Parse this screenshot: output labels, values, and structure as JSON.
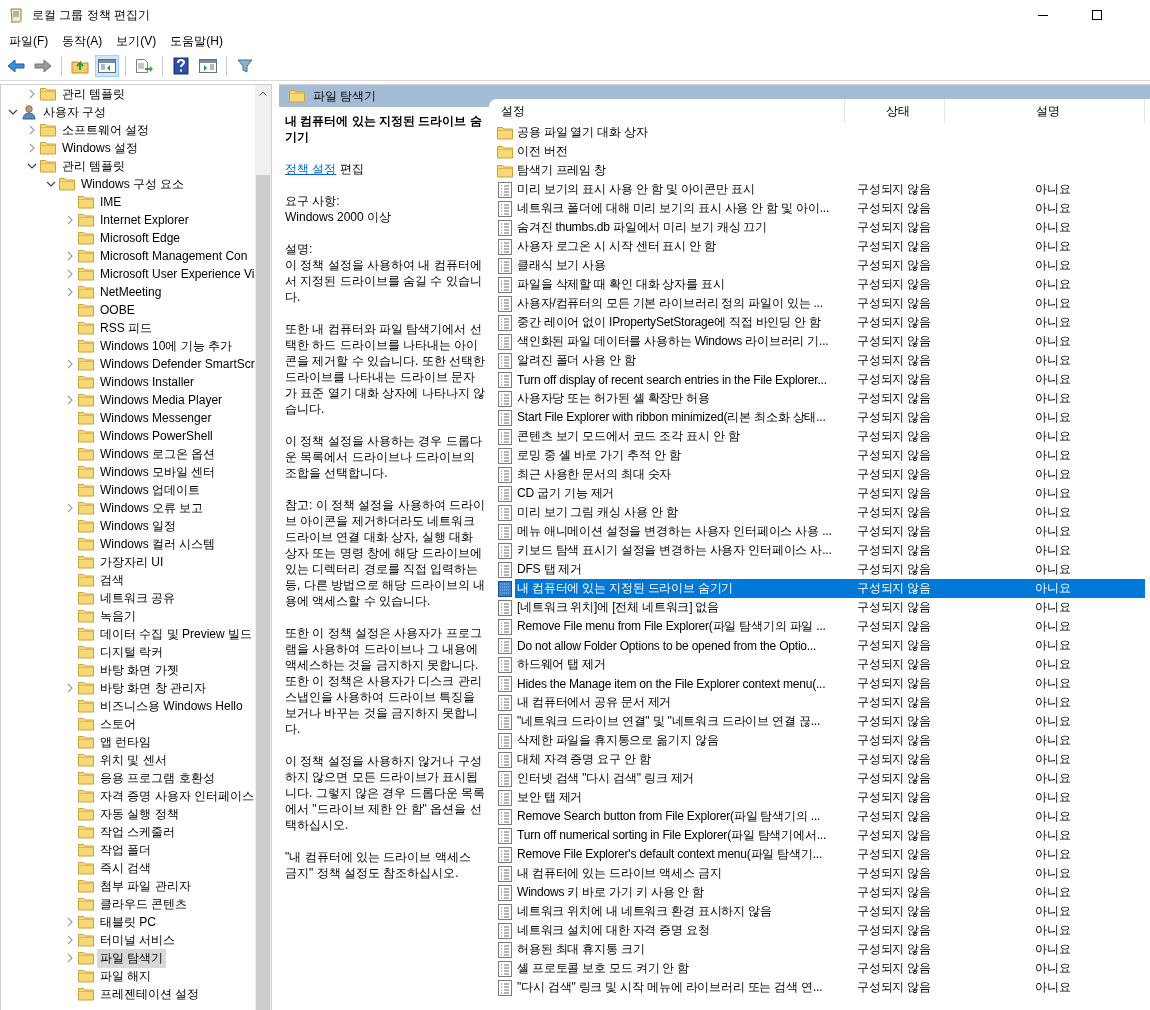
{
  "window": {
    "title": "로컬 그룹 정책 편집기"
  },
  "menu": [
    {
      "label": "파일(F)"
    },
    {
      "label": "동작(A)"
    },
    {
      "label": "보기(V)"
    },
    {
      "label": "도움말(H)"
    }
  ],
  "toolbar": [
    [
      {
        "kind": "back",
        "disabled": false,
        "pressed": false
      },
      {
        "kind": "forward",
        "disabled": true,
        "pressed": false
      }
    ],
    [
      {
        "kind": "up",
        "disabled": false,
        "pressed": false
      },
      {
        "kind": "tree-toggle",
        "disabled": false,
        "pressed": true
      }
    ],
    [
      {
        "kind": "export",
        "disabled": false,
        "pressed": false
      }
    ],
    [
      {
        "kind": "help",
        "disabled": false,
        "pressed": false
      },
      {
        "kind": "pane-toggle",
        "disabled": false,
        "pressed": false
      }
    ],
    [
      {
        "kind": "filter",
        "disabled": false,
        "pressed": false
      }
    ]
  ],
  "tree": [
    {
      "children": [
        {
          "label": "관리 템플릿",
          "kind": "folder",
          "expandable": true,
          "expanded": false,
          "selected": false
        }
      ]
    },
    {
      "label": "사용자 구성",
      "kind": "user",
      "expandable": true,
      "expanded": true,
      "selected": false,
      "children": [
        {
          "label": "소프트웨어 설정",
          "kind": "folder",
          "expandable": true,
          "expanded": false,
          "selected": false
        },
        {
          "label": "Windows 설정",
          "kind": "folder",
          "expandable": true,
          "expanded": false,
          "selected": false
        },
        {
          "label": "관리 템플릿",
          "kind": "folder",
          "expandable": true,
          "expanded": true,
          "selected": false,
          "children": [
            {
              "label": "Windows 구성 요소",
              "kind": "folder",
              "expandable": true,
              "expanded": true,
              "selected": false,
              "children": [
                {
                  "label": "IME",
                  "kind": "folder",
                  "expandable": false,
                  "selected": false
                },
                {
                  "label": "Internet Explorer",
                  "kind": "folder",
                  "expandable": true,
                  "expanded": false,
                  "selected": false
                },
                {
                  "label": "Microsoft Edge",
                  "kind": "folder",
                  "expandable": false,
                  "selected": false
                },
                {
                  "label": "Microsoft Management Con",
                  "kind": "folder",
                  "expandable": true,
                  "expanded": false,
                  "selected": false
                },
                {
                  "label": "Microsoft User Experience Vi",
                  "kind": "folder",
                  "expandable": true,
                  "expanded": false,
                  "selected": false
                },
                {
                  "label": "NetMeeting",
                  "kind": "folder",
                  "expandable": true,
                  "expanded": false,
                  "selected": false
                },
                {
                  "label": "OOBE",
                  "kind": "folder",
                  "expandable": false,
                  "selected": false
                },
                {
                  "label": "RSS 피드",
                  "kind": "folder",
                  "expandable": false,
                  "selected": false
                },
                {
                  "label": "Windows 10에 기능 추가",
                  "kind": "folder",
                  "expandable": false,
                  "selected": false
                },
                {
                  "label": "Windows Defender SmartScr",
                  "kind": "folder",
                  "expandable": true,
                  "expanded": false,
                  "selected": false
                },
                {
                  "label": "Windows Installer",
                  "kind": "folder",
                  "expandable": false,
                  "selected": false
                },
                {
                  "label": "Windows Media Player",
                  "kind": "folder",
                  "expandable": true,
                  "expanded": false,
                  "selected": false
                },
                {
                  "label": "Windows Messenger",
                  "kind": "folder",
                  "expandable": false,
                  "selected": false
                },
                {
                  "label": "Windows PowerShell",
                  "kind": "folder",
                  "expandable": false,
                  "selected": false
                },
                {
                  "label": "Windows 로그온 옵션",
                  "kind": "folder",
                  "expandable": false,
                  "selected": false
                },
                {
                  "label": "Windows 모바일 센터",
                  "kind": "folder",
                  "expandable": false,
                  "selected": false
                },
                {
                  "label": "Windows 업데이트",
                  "kind": "folder",
                  "expandable": false,
                  "selected": false
                },
                {
                  "label": "Windows 오류 보고",
                  "kind": "folder",
                  "expandable": true,
                  "expanded": false,
                  "selected": false
                },
                {
                  "label": "Windows 일정",
                  "kind": "folder",
                  "expandable": false,
                  "selected": false
                },
                {
                  "label": "Windows 컬러 시스템",
                  "kind": "folder",
                  "expandable": false,
                  "selected": false
                },
                {
                  "label": "가장자리 UI",
                  "kind": "folder",
                  "expandable": false,
                  "selected": false
                },
                {
                  "label": "검색",
                  "kind": "folder",
                  "expandable": false,
                  "selected": false
                },
                {
                  "label": "네트워크 공유",
                  "kind": "folder",
                  "expandable": false,
                  "selected": false
                },
                {
                  "label": "녹음기",
                  "kind": "folder",
                  "expandable": false,
                  "selected": false
                },
                {
                  "label": "데이터 수집 및 Preview 빌드",
                  "kind": "folder",
                  "expandable": false,
                  "selected": false
                },
                {
                  "label": "디지털 락커",
                  "kind": "folder",
                  "expandable": false,
                  "selected": false
                },
                {
                  "label": "바탕 화면 가젯",
                  "kind": "folder",
                  "expandable": false,
                  "selected": false
                },
                {
                  "label": "바탕 화면 창 관리자",
                  "kind": "folder",
                  "expandable": true,
                  "expanded": false,
                  "selected": false
                },
                {
                  "label": "비즈니스용 Windows Hello",
                  "kind": "folder",
                  "expandable": false,
                  "selected": false
                },
                {
                  "label": "스토어",
                  "kind": "folder",
                  "expandable": false,
                  "selected": false
                },
                {
                  "label": "앱 런타임",
                  "kind": "folder",
                  "expandable": false,
                  "selected": false
                },
                {
                  "label": "위치 및 센서",
                  "kind": "folder",
                  "expandable": false,
                  "selected": false
                },
                {
                  "label": "응용 프로그램 호환성",
                  "kind": "folder",
                  "expandable": false,
                  "selected": false
                },
                {
                  "label": "자격 증명 사용자 인터페이스",
                  "kind": "folder",
                  "expandable": false,
                  "selected": false
                },
                {
                  "label": "자동 실행 정책",
                  "kind": "folder",
                  "expandable": false,
                  "selected": false
                },
                {
                  "label": "작업 스케줄러",
                  "kind": "folder",
                  "expandable": false,
                  "selected": false
                },
                {
                  "label": "작업 폴더",
                  "kind": "folder",
                  "expandable": false,
                  "selected": false
                },
                {
                  "label": "즉시 검색",
                  "kind": "folder",
                  "expandable": false,
                  "selected": false
                },
                {
                  "label": "첨부 파일 관리자",
                  "kind": "folder",
                  "expandable": false,
                  "selected": false
                },
                {
                  "label": "클라우드 콘텐츠",
                  "kind": "folder",
                  "expandable": false,
                  "selected": false
                },
                {
                  "label": "태블릿 PC",
                  "kind": "folder",
                  "expandable": true,
                  "expanded": false,
                  "selected": false
                },
                {
                  "label": "터미널 서비스",
                  "kind": "folder",
                  "expandable": true,
                  "expanded": false,
                  "selected": false
                },
                {
                  "label": "파일 탐색기",
                  "kind": "folder",
                  "expandable": true,
                  "expanded": false,
                  "selected": true
                },
                {
                  "label": "파일 해지",
                  "kind": "folder",
                  "expandable": false,
                  "selected": false
                },
                {
                  "label": "프레젠테이션 설정",
                  "kind": "folder",
                  "expandable": false,
                  "selected": false
                }
              ]
            }
          ]
        }
      ]
    }
  ],
  "pane_header": {
    "title": "파일 탐색기"
  },
  "description": {
    "title": "내 컴퓨터에 있는 지정된 드라이브 숨기기",
    "edit_link": "정책 설정",
    "edit_suffix": "편집",
    "requirements_label": "요구 사항:",
    "requirements": "Windows 2000 이상",
    "description_label": "설명:",
    "paragraphs": [
      "이 정책 설정을 사용하여 내 컴퓨터에서 지정된 드라이브를 숨길 수 있습니다.",
      "또한 내 컴퓨터와 파일 탐색기에서 선택한 하드 드라이브를 나타내는 아이콘을 제거할 수 있습니다. 또한 선택한 드라이브를 나타내는 드라이브 문자가 표준 열기 대화 상자에 나타나지 않습니다.",
      "이 정책 설정을 사용하는 경우 드롭다운 목록에서 드라이브나 드라이브의 조합을 선택합니다.",
      "참고: 이 정책 설정을 사용하여 드라이브 아이콘을 제거하더라도 네트워크 드라이브 연결 대화 상자, 실행 대화 상자 또는 명령 창에 해당 드라이브에 있는 디렉터리 경로를 직접 입력하는 등, 다른 방법으로 해당 드라이브의 내용에 액세스할 수 있습니다.",
      "또한 이 정책 설정은 사용자가 프로그램을 사용하여 드라이브나 그 내용에 액세스하는 것을 금지하지 못합니다. 또한 이 정책은 사용자가 디스크 관리 스냅인을 사용하여 드라이브 특징을 보거나 바꾸는 것을 금지하지 못합니다.",
      "이 정책 설정을 사용하지 않거나 구성하지 않으면 모든 드라이브가 표시됩니다. 그렇지 않은 경우 드롭다운 목록에서 \"드라이브 제한 안 함\" 옵션을 선택하십시오.",
      "\"내 컴퓨터에 있는 드라이브 액세스 금지\" 정책 설정도 참조하십시오."
    ]
  },
  "table": {
    "columns": [
      "설정",
      "상태",
      "설명"
    ],
    "rows": [
      {
        "kind": "folder",
        "name": "공용 파일 열기 대화 상자",
        "selected": false
      },
      {
        "kind": "folder",
        "name": "이전 버전",
        "selected": false
      },
      {
        "kind": "folder",
        "name": "탐색기 프레임 창",
        "selected": false
      },
      {
        "kind": "setting",
        "name": "미리 보기의 표시 사용 안 함 및 아이콘만 표시",
        "state": "구성되지 않음",
        "comment": "아니요",
        "selected": false
      },
      {
        "kind": "setting",
        "name": "네트워크 폴더에 대해 미리 보기의 표시 사용 안 함 및 아이...",
        "state": "구성되지 않음",
        "comment": "아니요",
        "selected": false
      },
      {
        "kind": "setting",
        "name": "숨겨진 thumbs.db 파일에서 미리 보기 캐싱 끄기",
        "state": "구성되지 않음",
        "comment": "아니요",
        "selected": false
      },
      {
        "kind": "setting",
        "name": "사용자 로그온 시 시작 센터 표시 안 함",
        "state": "구성되지 않음",
        "comment": "아니요",
        "selected": false
      },
      {
        "kind": "setting",
        "name": "클래식 보기 사용",
        "state": "구성되지 않음",
        "comment": "아니요",
        "selected": false
      },
      {
        "kind": "setting",
        "name": "파일을 삭제할 때 확인 대화 상자를 표시",
        "state": "구성되지 않음",
        "comment": "아니요",
        "selected": false
      },
      {
        "kind": "setting",
        "name": "사용자/컴퓨터의 모든 기본 라이브러리 정의 파일이 있는 ...",
        "state": "구성되지 않음",
        "comment": "아니요",
        "selected": false
      },
      {
        "kind": "setting",
        "name": "중간 레이어 없이 IPropertySetStorage에 직접 바인딩 안 함",
        "state": "구성되지 않음",
        "comment": "아니요",
        "selected": false
      },
      {
        "kind": "setting",
        "name": "색인화된 파일 데이터를 사용하는 Windows 라이브러리 기...",
        "state": "구성되지 않음",
        "comment": "아니요",
        "selected": false
      },
      {
        "kind": "setting",
        "name": "알려진 폴더 사용 안 함",
        "state": "구성되지 않음",
        "comment": "아니요",
        "selected": false
      },
      {
        "kind": "setting",
        "name": "Turn off display of recent search entries in the File Explorer...",
        "state": "구성되지 않음",
        "comment": "아니요",
        "selected": false
      },
      {
        "kind": "setting",
        "name": "사용자당 또는 허가된 셸 확장만 허용",
        "state": "구성되지 않음",
        "comment": "아니요",
        "selected": false
      },
      {
        "kind": "setting",
        "name": "Start File Explorer with ribbon minimized(리본 최소화 상태...",
        "state": "구성되지 않음",
        "comment": "아니요",
        "selected": false
      },
      {
        "kind": "setting",
        "name": "콘텐츠 보기 모드에서 코드 조각 표시 안 함",
        "state": "구성되지 않음",
        "comment": "아니요",
        "selected": false
      },
      {
        "kind": "setting",
        "name": "로밍 중 셸 바로 가기 추적 안 함",
        "state": "구성되지 않음",
        "comment": "아니요",
        "selected": false
      },
      {
        "kind": "setting",
        "name": "최근 사용한 문서의 최대 숫자",
        "state": "구성되지 않음",
        "comment": "아니요",
        "selected": false
      },
      {
        "kind": "setting",
        "name": "CD 굽기 기능 제거",
        "state": "구성되지 않음",
        "comment": "아니요",
        "selected": false
      },
      {
        "kind": "setting",
        "name": "미리 보기 그림 캐싱 사용 안 함",
        "state": "구성되지 않음",
        "comment": "아니요",
        "selected": false
      },
      {
        "kind": "setting",
        "name": "메뉴 애니메이션 설정을 변경하는 사용자 인터페이스 사용 ...",
        "state": "구성되지 않음",
        "comment": "아니요",
        "selected": false
      },
      {
        "kind": "setting",
        "name": "키보드 탐색 표시기 설정을 변경하는 사용자 인터페이스 사...",
        "state": "구성되지 않음",
        "comment": "아니요",
        "selected": false
      },
      {
        "kind": "setting",
        "name": "DFS 탭 제거",
        "state": "구성되지 않음",
        "comment": "아니요",
        "selected": false
      },
      {
        "kind": "setting",
        "name": "내 컴퓨터에 있는 지정된 드라이브 숨기기",
        "state": "구성되지 않음",
        "comment": "아니요",
        "selected": true
      },
      {
        "kind": "setting",
        "name": "[네트워크 위치]에 [전체 네트워크] 없음",
        "state": "구성되지 않음",
        "comment": "아니요",
        "selected": false
      },
      {
        "kind": "setting",
        "name": "Remove File menu from File Explorer(파일 탐색기의 파일 ...",
        "state": "구성되지 않음",
        "comment": "아니요",
        "selected": false
      },
      {
        "kind": "setting",
        "name": "Do not allow Folder Options to be opened from the Optio...",
        "state": "구성되지 않음",
        "comment": "아니요",
        "selected": false
      },
      {
        "kind": "setting",
        "name": "하드웨어 탭 제거",
        "state": "구성되지 않음",
        "comment": "아니요",
        "selected": false
      },
      {
        "kind": "setting",
        "name": "Hides the Manage item on the File Explorer context menu(...",
        "state": "구성되지 않음",
        "comment": "아니요",
        "selected": false
      },
      {
        "kind": "setting",
        "name": "내 컴퓨터에서 공유 문서 제거",
        "state": "구성되지 않음",
        "comment": "아니요",
        "selected": false
      },
      {
        "kind": "setting",
        "name": "\"네트워크 드라이브 연결\" 및 \"네트워크 드라이브 연결 끊...",
        "state": "구성되지 않음",
        "comment": "아니요",
        "selected": false
      },
      {
        "kind": "setting",
        "name": "삭제한 파일을 휴지통으로 옮기지 않음",
        "state": "구성되지 않음",
        "comment": "아니요",
        "selected": false
      },
      {
        "kind": "setting",
        "name": "대체 자격 증명 요구 안 함",
        "state": "구성되지 않음",
        "comment": "아니요",
        "selected": false
      },
      {
        "kind": "setting",
        "name": "인터넷 검색 \"다시 검색\" 링크 제거",
        "state": "구성되지 않음",
        "comment": "아니요",
        "selected": false
      },
      {
        "kind": "setting",
        "name": "보안 탭 제거",
        "state": "구성되지 않음",
        "comment": "아니요",
        "selected": false
      },
      {
        "kind": "setting",
        "name": "Remove Search button from File Explorer(파일 탐색기의 ...",
        "state": "구성되지 않음",
        "comment": "아니요",
        "selected": false
      },
      {
        "kind": "setting",
        "name": "Turn off numerical sorting in File Explorer(파일 탐색기에서...",
        "state": "구성되지 않음",
        "comment": "아니요",
        "selected": false
      },
      {
        "kind": "setting",
        "name": "Remove File Explorer's default context menu(파일 탐색기...",
        "state": "구성되지 않음",
        "comment": "아니요",
        "selected": false
      },
      {
        "kind": "setting",
        "name": "내 컴퓨터에 있는 드라이브 액세스 금지",
        "state": "구성되지 않음",
        "comment": "아니요",
        "selected": false
      },
      {
        "kind": "setting",
        "name": "Windows 키 바로 가기 키 사용 안 함",
        "state": "구성되지 않음",
        "comment": "아니요",
        "selected": false
      },
      {
        "kind": "setting",
        "name": "네트워크 위치에 내 네트워크 환경 표시하지 않음",
        "state": "구성되지 않음",
        "comment": "아니요",
        "selected": false
      },
      {
        "kind": "setting",
        "name": "네트워크 설치에 대한 자격 증명 요청",
        "state": "구성되지 않음",
        "comment": "아니요",
        "selected": false
      },
      {
        "kind": "setting",
        "name": "허용된 최대 휴지통 크기",
        "state": "구성되지 않음",
        "comment": "아니요",
        "selected": false
      },
      {
        "kind": "setting",
        "name": "셸 프로토콜 보호 모드 켜기 안 함",
        "state": "구성되지 않음",
        "comment": "아니요",
        "selected": false
      },
      {
        "kind": "setting",
        "name": "\"다시 검색\" 링크 및 시작 메뉴에 라이브러리 또는 검색 연...",
        "state": "구성되지 않음",
        "comment": "아니요",
        "selected": false
      }
    ]
  }
}
